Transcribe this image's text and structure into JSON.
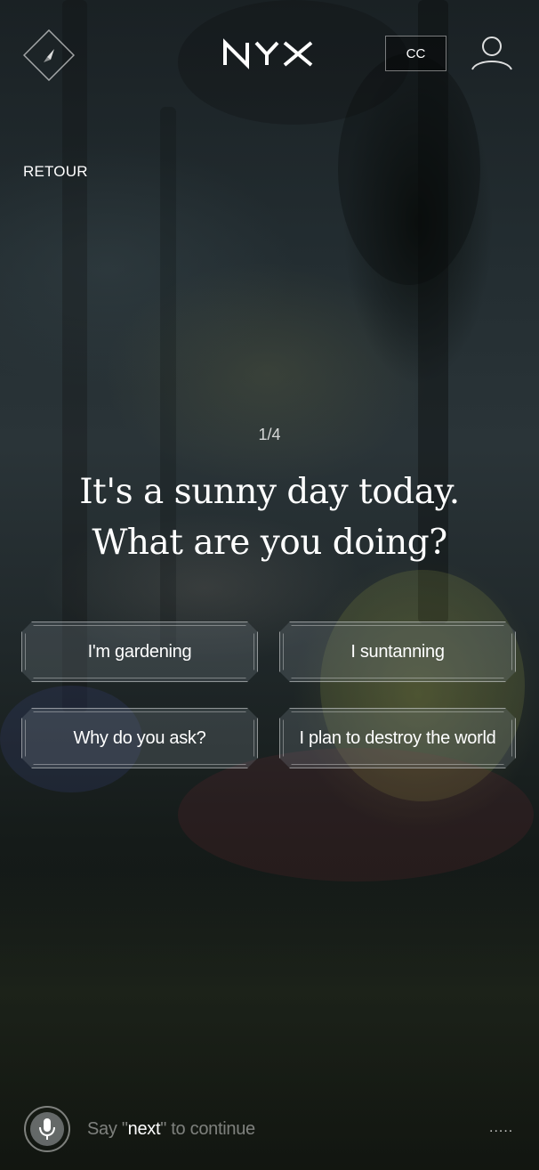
{
  "header": {
    "logo": "NYX",
    "cc_label": "CC",
    "compass_icon": "compass-icon",
    "user_icon": "user-icon"
  },
  "nav": {
    "back_label": "RETOUR"
  },
  "quiz": {
    "progress": "1/4",
    "question_line1": "It's a sunny day today.",
    "question_line2": "What are you doing?",
    "answers": [
      {
        "label": "I'm gardening"
      },
      {
        "label": "I suntanning"
      },
      {
        "label": "Why do you ask?"
      },
      {
        "label": "I plan to destroy the world"
      }
    ]
  },
  "voice": {
    "mic_icon": "microphone-icon",
    "hint_prefix": "Say \"",
    "hint_keyword": "next",
    "hint_suffix": "\" to continue",
    "more_label": "....."
  },
  "colors": {
    "text": "#ffffff",
    "background": "#1a2124",
    "button_fill": "#78828a",
    "muted_text": "#8a9090"
  }
}
